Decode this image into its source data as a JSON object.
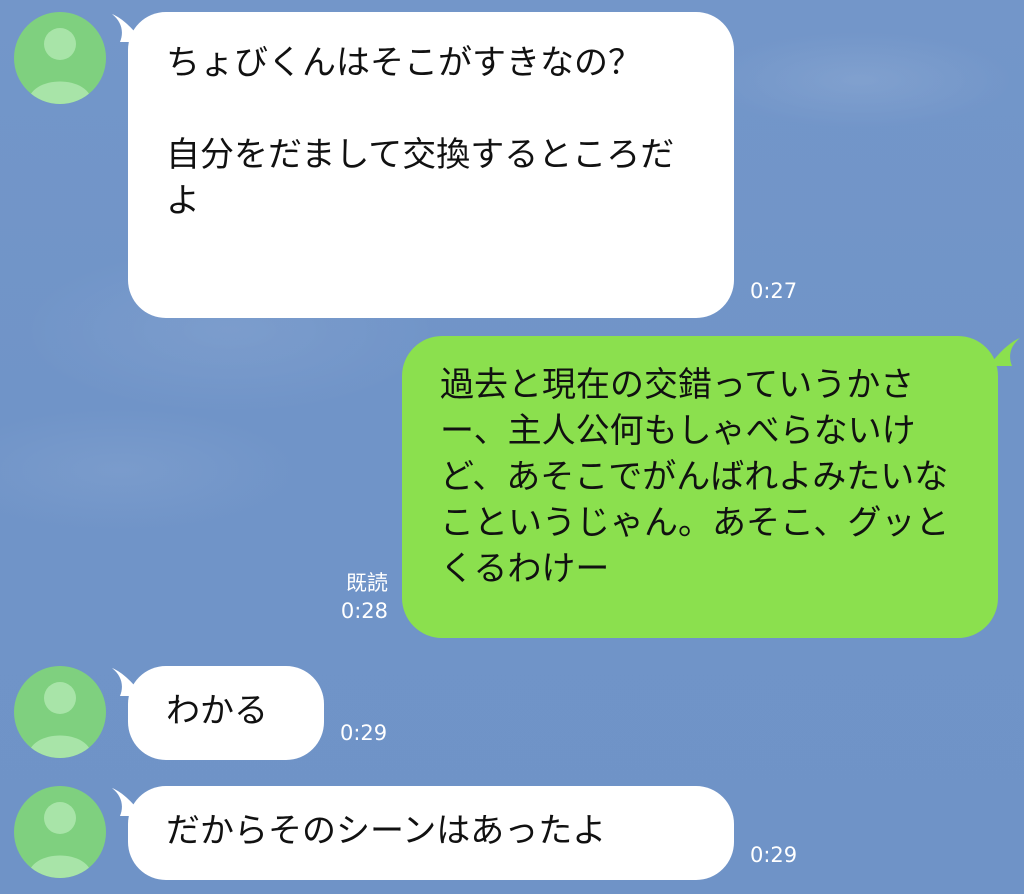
{
  "messages": [
    {
      "from": "other",
      "text": "ちょびくんはそこがすきなの？\n\n自分をだまして交換するところだよ",
      "time": "0:27"
    },
    {
      "from": "me",
      "text": "過去と現在の交錯っていうかさー、主人公何もしゃべらないけど、あそこでがんばれよみたいなこというじゃん。あそこ、グッとくるわけー",
      "read_label": "既読",
      "time": "0:28"
    },
    {
      "from": "other",
      "text": "わかる",
      "time": "0:29"
    },
    {
      "from": "other",
      "text": "だからそのシーンはあったよ",
      "time": "0:29"
    }
  ],
  "colors": {
    "background": "#7094c8",
    "incoming_bubble": "#ffffff",
    "outgoing_bubble": "#8be04e",
    "avatar": "#7fd07f",
    "meta_text": "#ffffff"
  },
  "icons": {
    "avatar": "default-user-silhouette-icon"
  }
}
